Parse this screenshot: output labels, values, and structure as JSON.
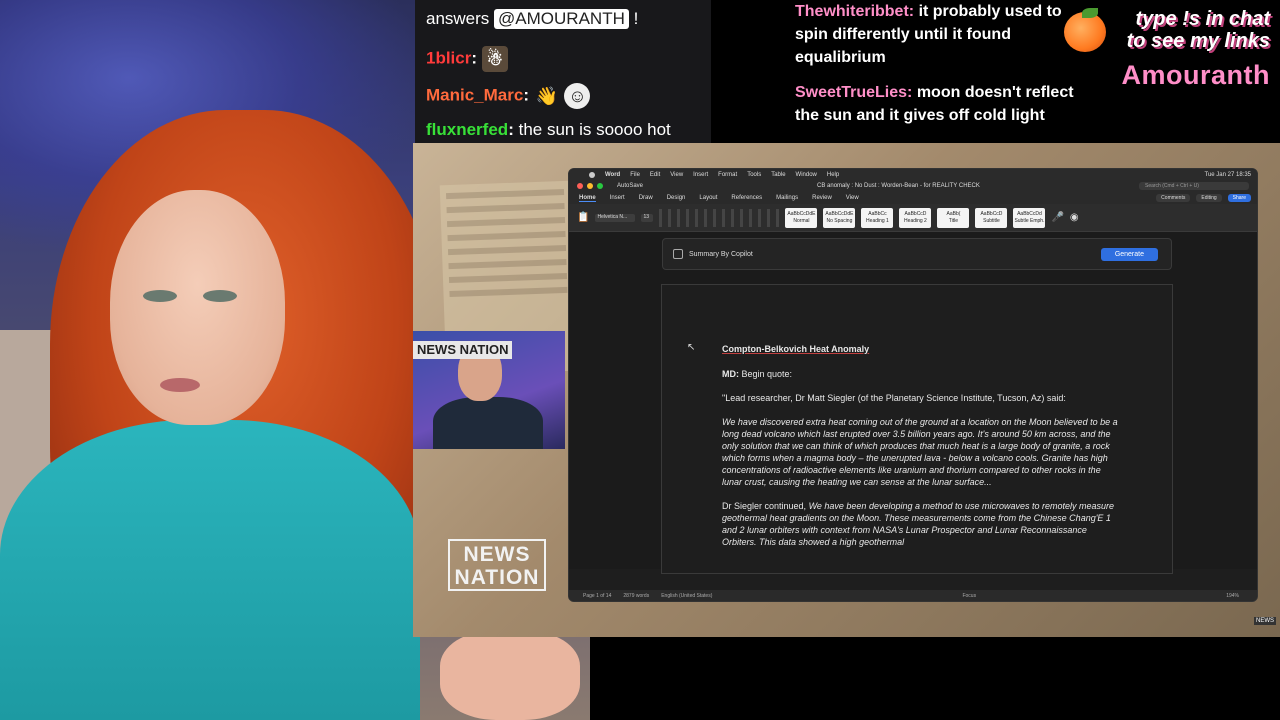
{
  "chat_left": {
    "top_message": {
      "text": "answers",
      "mention": "@AMOURANTH",
      "suffix": "!"
    },
    "messages": [
      {
        "user": "1blicr",
        "user_color": "#ff3b3b",
        "sep": ":",
        "text": "",
        "emotes": [
          "figure-emote"
        ]
      },
      {
        "user": "Manic_Marc",
        "user_color": "#ff6a3d",
        "sep": ":",
        "text": "",
        "emotes": [
          "wave-emote",
          "face-emote"
        ]
      },
      {
        "user": "fluxnerfed",
        "user_color": "#38e038",
        "sep": ":",
        "text": "the sun is soooo hot",
        "emotes": []
      }
    ]
  },
  "chat_right": {
    "messages": [
      {
        "user": "Thewhiteribbet",
        "user_color": "#ff8fc8",
        "text": "it probably used to spin differently until it found equalibrium"
      },
      {
        "user": "SweetTrueLies",
        "user_color": "#ff8fc8",
        "text": "moon doesn't reflect the sun and it gives off cold light"
      }
    ]
  },
  "cta": {
    "line1": "type !s in chat",
    "line2": "to see my links",
    "brand": "Amouranth",
    "icon": "peach-icon"
  },
  "news": {
    "guest_tag": "NEWS NATION",
    "logo_line1": "NEWS",
    "logo_line2": "NATION",
    "corner_logo": "NEWS"
  },
  "word": {
    "menubar": [
      "Word",
      "File",
      "Edit",
      "View",
      "Insert",
      "Format",
      "Tools",
      "Table",
      "Window",
      "Help"
    ],
    "clock": "Tue Jan 27 18:35",
    "autosave": "AutoSave",
    "doc_title": "CB anomaly : No Dust : Worden-Bean - for REALITY CHECK",
    "search_placeholder": "Search (Cmd + Ctrl + U)",
    "tabs": [
      "Home",
      "Insert",
      "Draw",
      "Design",
      "Layout",
      "References",
      "Mailings",
      "Review",
      "View"
    ],
    "comments_label": "Comments",
    "editing_label": "Editing",
    "share_label": "Share",
    "font_name": "Helvetica N...",
    "font_size": "13",
    "styles": [
      {
        "sample": "AaBbCcDdE",
        "name": "Normal"
      },
      {
        "sample": "AaBbCcDdE",
        "name": "No Spacing"
      },
      {
        "sample": "AaBbCc",
        "name": "Heading 1"
      },
      {
        "sample": "AaBbCcD",
        "name": "Heading 2"
      },
      {
        "sample": "AaBb(",
        "name": "Title"
      },
      {
        "sample": "AaBbCcD",
        "name": "Subtitle"
      },
      {
        "sample": "AaBbCcDd",
        "name": "Subtle Emph."
      }
    ],
    "copilot_label": "Summary By Copilot",
    "generate_label": "Generate",
    "doc": {
      "heading": "Compton-Belkovich Heat Anomaly",
      "md_label": "MD:",
      "md_text": "Begin quote:",
      "lead": "\"Lead researcher, Dr Matt Siegler (of the Planetary Science Institute, Tucson, Az) said:",
      "quote": "We have discovered extra heat coming out of the ground at a location on the Moon believed to be a long dead volcano which last erupted over 3.5 billion years ago. It's around 50 km across, and the only solution that we can think of which produces that much heat is a large body of granite, a rock which forms when a magma body – the unerupted lava - below a volcano cools. Granite has high concentrations of radioactive elements like uranium and thorium compared to other rocks in the lunar crust, causing the heating we can sense at the lunar surface...",
      "continued_prefix": "Dr Siegler continued,",
      "continued": "We have been developing a method to use microwaves to remotely measure geothermal heat gradients on the Moon. These measurements come from the Chinese Chang'E 1 and 2 lunar orbiters with context from NASA's Lunar Prospector and Lunar Reconnaissance Orbiters. This data showed a high geothermal"
    },
    "status": {
      "page": "Page 1 of 14",
      "words": "2879 words",
      "lang": "English (United States)",
      "focus": "Focus",
      "zoom": "194%"
    }
  }
}
